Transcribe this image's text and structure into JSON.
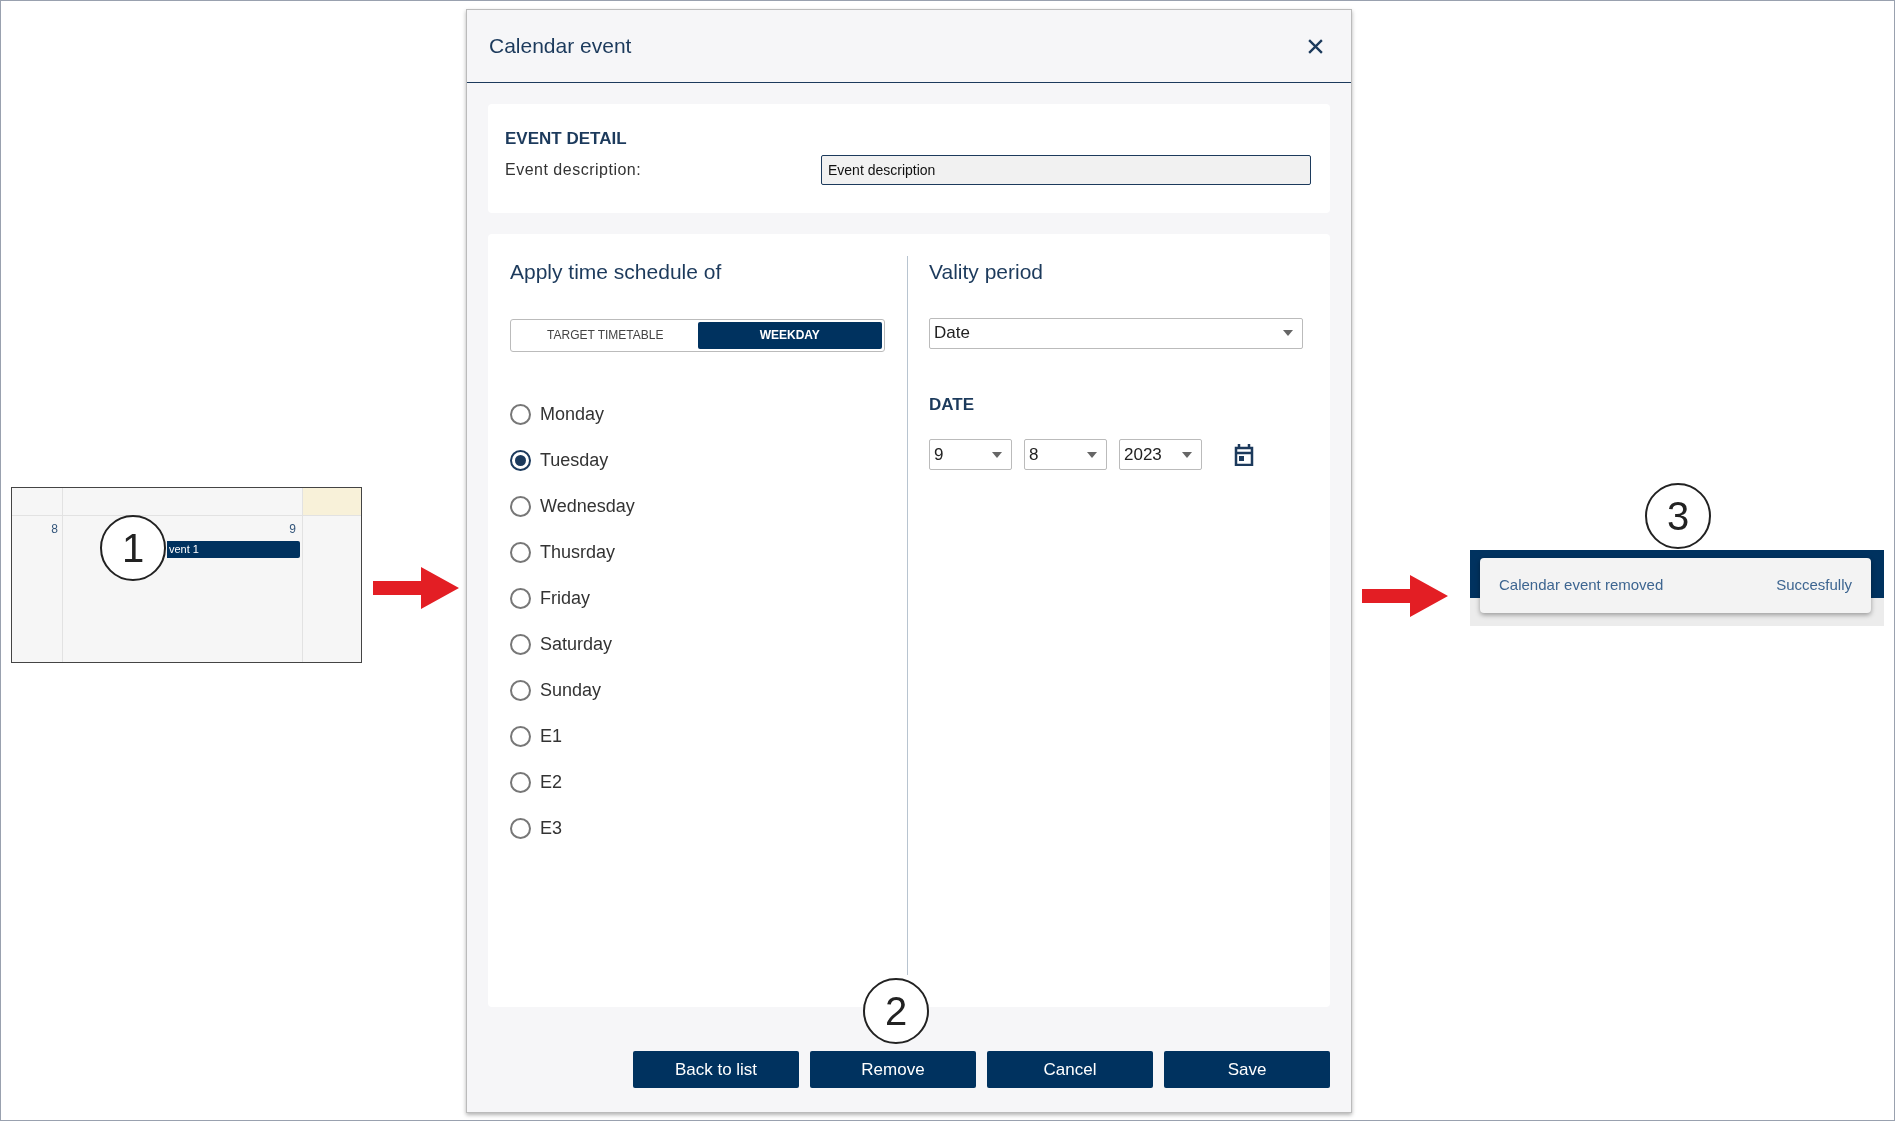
{
  "calendar_thumbnail": {
    "day_numbers": [
      "8",
      "9"
    ],
    "event_label": "vent 1"
  },
  "callouts": [
    "1",
    "2",
    "3"
  ],
  "dialog": {
    "title": "Calendar event",
    "event_detail": {
      "heading": "EVENT DETAIL",
      "label": "Event description:",
      "value": "Event description"
    },
    "schedule": {
      "heading": "Apply time schedule of",
      "toggle": [
        {
          "label": "TARGET TIMETABLE",
          "selected": false
        },
        {
          "label": "WEEKDAY",
          "selected": true
        }
      ],
      "options": [
        {
          "label": "Monday",
          "selected": false
        },
        {
          "label": "Tuesday",
          "selected": true
        },
        {
          "label": "Wednesday",
          "selected": false
        },
        {
          "label": "Thusrday",
          "selected": false
        },
        {
          "label": "Friday",
          "selected": false
        },
        {
          "label": "Saturday",
          "selected": false
        },
        {
          "label": "Sunday",
          "selected": false
        },
        {
          "label": "E1",
          "selected": false
        },
        {
          "label": "E2",
          "selected": false
        },
        {
          "label": "E3",
          "selected": false
        }
      ]
    },
    "validity": {
      "heading": "Vality period",
      "type_select": "Date",
      "date_heading": "DATE",
      "date_selects": [
        "9",
        "8",
        "2023"
      ]
    },
    "buttons": [
      "Back to list",
      "Remove",
      "Cancel",
      "Save"
    ]
  },
  "toast": {
    "message": "Calendar event removed",
    "status": "Succesfully"
  }
}
